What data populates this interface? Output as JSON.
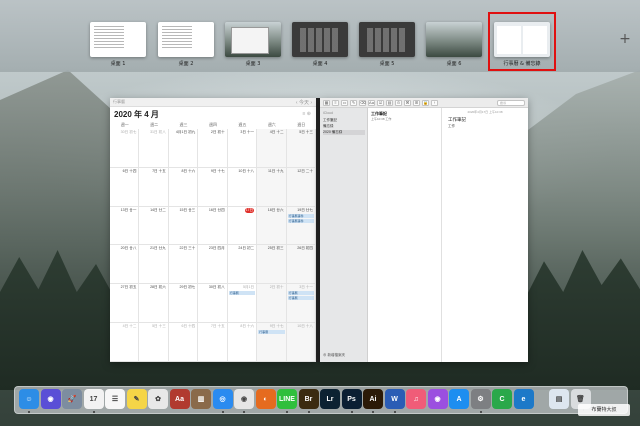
{
  "spaces": [
    {
      "label": "桌面 1"
    },
    {
      "label": "桌面 2"
    },
    {
      "label": "桌面 3"
    },
    {
      "label": "桌面 4"
    },
    {
      "label": "桌面 5"
    },
    {
      "label": "桌面 6"
    },
    {
      "label": "行事曆 & 備忘錄"
    }
  ],
  "add_space_label": "+",
  "calendar": {
    "toolbar_left": "行事曆",
    "nav": "‹  今天  ›",
    "title": "2020 年 4 月",
    "title_icons": "≡  ⊕",
    "weekdays": [
      "週一",
      "週二",
      "週三",
      "週四",
      "週五",
      "週六",
      "週日"
    ],
    "cells": [
      {
        "label": "30日 初七"
      },
      {
        "label": "31日 初八"
      },
      {
        "label": "4月1日 初九"
      },
      {
        "label": "2日 初十"
      },
      {
        "label": "3日 十一"
      },
      {
        "label": "4日 十二"
      },
      {
        "label": "5日 十三"
      },
      {
        "label": "6日 十四"
      },
      {
        "label": "7日 十五"
      },
      {
        "label": "8日 十六"
      },
      {
        "label": "9日 十七"
      },
      {
        "label": "10日 十八"
      },
      {
        "label": "11日 十九"
      },
      {
        "label": "12日 二十"
      },
      {
        "label": "13日 廿一"
      },
      {
        "label": "14日 廿二"
      },
      {
        "label": "15日 廿三"
      },
      {
        "label": "16日 廿四"
      },
      {
        "label": "17日"
      },
      {
        "label": "18日 廿六"
      },
      {
        "label": "19日 廿七"
      },
      {
        "label": "20日 廿八"
      },
      {
        "label": "21日 廿九"
      },
      {
        "label": "22日 三十"
      },
      {
        "label": "23日 四月"
      },
      {
        "label": "24日 初二"
      },
      {
        "label": "25日 初三"
      },
      {
        "label": "26日 初四"
      },
      {
        "label": "27日 初五"
      },
      {
        "label": "28日 初六"
      },
      {
        "label": "29日 初七"
      },
      {
        "label": "30日 初八"
      },
      {
        "label": "5月1日"
      },
      {
        "label": "2日 初十"
      },
      {
        "label": "3日 十一"
      },
      {
        "label": "4日 十二"
      },
      {
        "label": "5日 十三"
      },
      {
        "label": "6日 十四"
      },
      {
        "label": "7日 十五"
      },
      {
        "label": "8日 十六"
      },
      {
        "label": "9日 十七"
      },
      {
        "label": "10日 十八"
      }
    ],
    "events": {
      "e1": "行事曆事件",
      "e2": "行事曆事件",
      "e3": "行事曆",
      "e4": "行事曆",
      "e5": "行事曆",
      "e6": "行事曆"
    }
  },
  "notes": {
    "toolbar_buttons": [
      "▦",
      "≡",
      "▭",
      "✎",
      "⌫",
      "Aa",
      "☑",
      "▤",
      "⊙",
      "⌘",
      "⊞",
      "🔒",
      "↑"
    ],
    "search_placeholder": "搜尋",
    "sidebar_header": "iCloud",
    "sidebar_items": [
      "工作筆記",
      "備忘錄",
      "2020 備忘錄"
    ],
    "new_folder": "⊕ 新增檔案夾",
    "list_item_title": "工作筆記",
    "list_item_sub": "上午10:38  工作",
    "note_date": "2020年4月17日 上午10:38",
    "note_title": "工作筆記",
    "note_text": "工作"
  },
  "dock": {
    "icons": [
      {
        "name": "finder-icon",
        "text": "☺",
        "color": "#2d8de6"
      },
      {
        "name": "siri-icon",
        "text": "◉",
        "color": "#5a4fd6"
      },
      {
        "name": "launchpad-icon",
        "text": "🚀",
        "color": "#7d8da0"
      },
      {
        "name": "calendar-icon",
        "text": "17",
        "color": "#f2f2f2"
      },
      {
        "name": "reminders-icon",
        "text": "☰",
        "color": "#f7f7f7"
      },
      {
        "name": "notes-icon",
        "text": "✎",
        "color": "#f5d547"
      },
      {
        "name": "photos-icon",
        "text": "✿",
        "color": "#e8e8e8"
      },
      {
        "name": "dictionary-icon",
        "text": "Aa",
        "color": "#b13a2f"
      },
      {
        "name": "preview-icon",
        "text": "▥",
        "color": "#8a6a4a"
      },
      {
        "name": "safari-icon",
        "text": "◎",
        "color": "#2a8bf0"
      },
      {
        "name": "chrome-icon",
        "text": "◉",
        "color": "#e6e6e6"
      },
      {
        "name": "firefox-icon",
        "text": "◐",
        "color": "#e56b1f"
      },
      {
        "name": "line-icon",
        "text": "LINE",
        "color": "#2fbf3c"
      },
      {
        "name": "bridge-icon",
        "text": "Br",
        "color": "#3b2b10"
      },
      {
        "name": "lightroom-icon",
        "text": "Lr",
        "color": "#0c2232"
      },
      {
        "name": "photoshop-icon",
        "text": "Ps",
        "color": "#0b1f33"
      },
      {
        "name": "illustrator-icon",
        "text": "Ai",
        "color": "#2b1a07"
      },
      {
        "name": "word-icon",
        "text": "W",
        "color": "#2b5db5"
      },
      {
        "name": "music-icon",
        "text": "♫",
        "color": "#f05c78"
      },
      {
        "name": "podcasts-icon",
        "text": "◉",
        "color": "#9b4fe0"
      },
      {
        "name": "app-store-icon",
        "text": "A",
        "color": "#1d8ef0"
      },
      {
        "name": "system-preferences-icon",
        "text": "⚙",
        "color": "#7d7f82"
      },
      {
        "name": "camtasia-icon",
        "text": "C",
        "color": "#2aa84a"
      },
      {
        "name": "edge-icon",
        "text": "e",
        "color": "#1d79c8"
      },
      {
        "name": "downloads-icon",
        "text": "▤",
        "color": "#dde6ef"
      },
      {
        "name": "trash-icon",
        "text": "🗑",
        "color": "#d9dcde"
      }
    ]
  },
  "watermark": "布蘭特大叔"
}
